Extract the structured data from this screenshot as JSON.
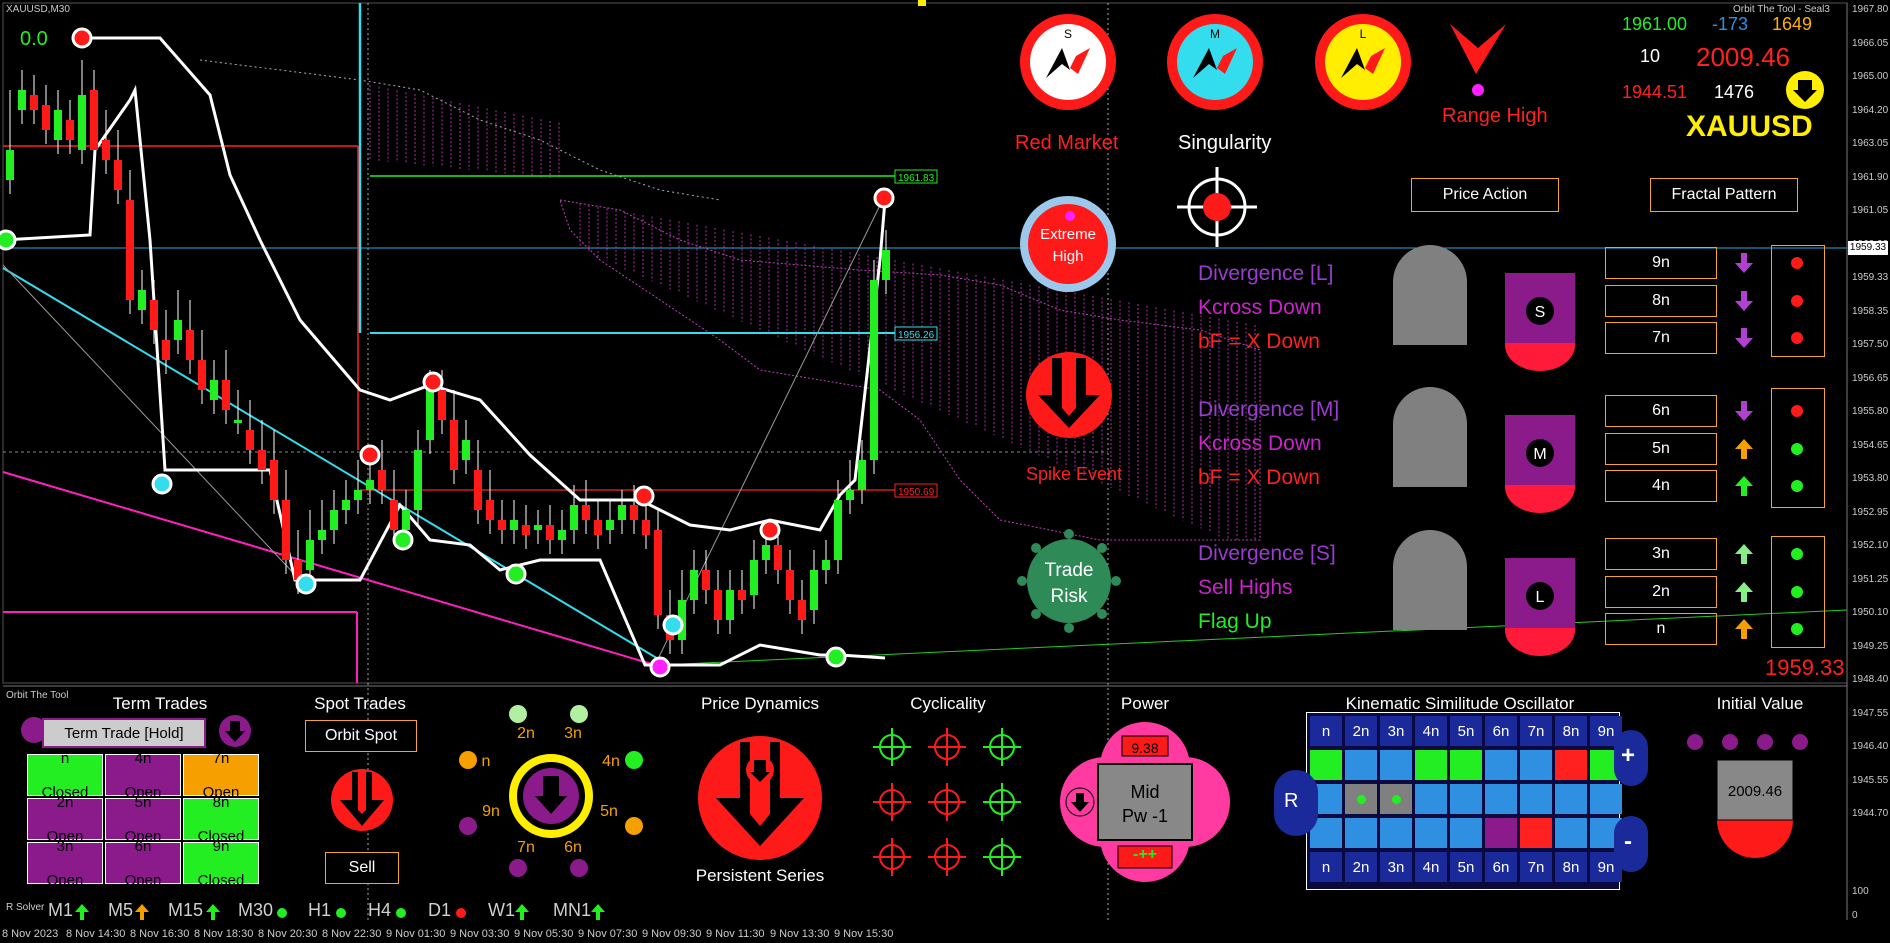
{
  "window": {
    "symbol_tf": "XAUUSD,M30",
    "brand": "Orbit The Tool - Seal3",
    "zero_label": "0.0"
  },
  "price_scale": [
    "1967.80",
    "1966.05",
    "1965.00",
    "1964.20",
    "1963.05",
    "1961.90",
    "1961.05",
    "1960.20",
    "1959.33",
    "1958.35",
    "1957.50",
    "1956.65",
    "1955.80",
    "1954.65",
    "1953.80",
    "1952.95",
    "1952.10",
    "1951.25",
    "1950.10",
    "1949.25",
    "1948.40",
    "1947.55",
    "1946.40",
    "1945.55",
    "1944.70"
  ],
  "current_price": "1959.33",
  "price_tags": {
    "top_green": "1961.83",
    "cyan": "1956.26",
    "red": "1950.69"
  },
  "time_axis": [
    "8 Nov 2023",
    "8 Nov 14:30",
    "8 Nov 16:30",
    "8 Nov 18:30",
    "8 Nov 20:30",
    "8 Nov 22:30",
    "9 Nov 01:30",
    "9 Nov 03:30",
    "9 Nov 05:30",
    "9 Nov 07:30",
    "9 Nov 09:30",
    "9 Nov 11:30",
    "9 Nov 13:30",
    "9 Nov 15:30"
  ],
  "bottom_scale": {
    "top": "100",
    "bottom": "0"
  },
  "top_right": {
    "v1": "1961.00",
    "v2": "-173",
    "v3": "1649",
    "v4": "10",
    "v5": "2009.46",
    "v6": "1944.51",
    "v7": "1476",
    "symbol": "XAUUSD"
  },
  "indicators": {
    "s_letter": "S",
    "m_letter": "M",
    "l_letter": "L",
    "red_market": "Red Market",
    "singularity": "Singularity",
    "range_high": "Range High",
    "extreme_high_1": "Extreme",
    "extreme_high_2": "High",
    "spike_event": "Spike Event",
    "trade_risk_1": "Trade",
    "trade_risk_2": "Risk",
    "price_action": "Price Action",
    "fractal_pattern": "Fractal Pattern"
  },
  "signals": {
    "l": [
      "Divergence [L]",
      "Kcross Down",
      "bF = X Down"
    ],
    "m": [
      "Divergence [M]",
      "Kcross Down",
      "bF = X Down"
    ],
    "s": [
      "Divergence [S]",
      "Sell Highs",
      "Flag Up"
    ]
  },
  "tf_gauges": [
    "S",
    "M",
    "L"
  ],
  "n_levels": [
    {
      "label": "9n",
      "arrow": "down",
      "dot": "red"
    },
    {
      "label": "8n",
      "arrow": "down",
      "dot": "red"
    },
    {
      "label": "7n",
      "arrow": "down",
      "dot": "red"
    },
    {
      "label": "6n",
      "arrow": "down",
      "dot": "red"
    },
    {
      "label": "5n",
      "arrow": "up-orange",
      "dot": "green"
    },
    {
      "label": "4n",
      "arrow": "up-green",
      "dot": "green"
    },
    {
      "label": "3n",
      "arrow": "up-lime",
      "dot": "green"
    },
    {
      "label": "2n",
      "arrow": "up-lime",
      "dot": "green"
    },
    {
      "label": "n",
      "arrow": "up-orange",
      "dot": "green"
    }
  ],
  "bottom": {
    "orbit_label": "Orbit The Tool",
    "term_title": "Term Trades",
    "term_hold": "Term Trade [Hold]",
    "term_cells": [
      {
        "l1": "n",
        "l2": "Closed",
        "color": "#22ee22"
      },
      {
        "l1": "4n",
        "l2": "Open",
        "color": "#8b1a8b"
      },
      {
        "l1": "7n",
        "l2": "Open",
        "color": "#f5a000"
      },
      {
        "l1": "2n",
        "l2": "Open",
        "color": "#8b1a8b"
      },
      {
        "l1": "5n",
        "l2": "Open",
        "color": "#8b1a8b"
      },
      {
        "l1": "8n",
        "l2": "Closed",
        "color": "#22ee22"
      },
      {
        "l1": "3n",
        "l2": "Open",
        "color": "#8b1a8b"
      },
      {
        "l1": "6n",
        "l2": "Open",
        "color": "#8b1a8b"
      },
      {
        "l1": "9n",
        "l2": "Closed",
        "color": "#22ee22"
      }
    ],
    "spot_title": "Spot Trades",
    "orbit_spot": "Orbit Spot",
    "sell": "Sell",
    "orbit_labels": [
      "2n",
      "3n",
      "n",
      "4n",
      "9n",
      "5n",
      "7n",
      "6n"
    ],
    "price_dynamics": "Price Dynamics",
    "persistent_series": "Persistent Series",
    "cyclicality": "Cyclicality",
    "power": "Power",
    "power_value": "9.38",
    "power_mid": "Mid",
    "power_pw": "Pw -1",
    "power_signs": "-++",
    "kso_title": "Kinematic Similitude Oscillator",
    "kso_header": [
      "n",
      "2n",
      "3n",
      "4n",
      "5n",
      "6n",
      "7n",
      "8n",
      "9n"
    ],
    "kso_row1": [
      "#22ee22",
      "#2f8fe0",
      "#2f8fe0",
      "#22ee22",
      "#22ee22",
      "#2f8fe0",
      "#2f8fe0",
      "#ff2020",
      "#22ee22"
    ],
    "kso_row2": [
      "#2f8fe0",
      "#808080",
      "#808080",
      "#2f8fe0",
      "#2f8fe0",
      "#2f8fe0",
      "#2f8fe0",
      "#2f8fe0",
      "#2f8fe0"
    ],
    "kso_row3": [
      "#2f8fe0",
      "#2f8fe0",
      "#2f8fe0",
      "#2f8fe0",
      "#2f8fe0",
      "#8b1a8b",
      "#ff2020",
      "#2f8fe0",
      "#2f8fe0"
    ],
    "kso_r": "R",
    "kso_plus": "+",
    "kso_minus": "-",
    "initial_value_title": "Initial Value",
    "initial_value": "2009.46",
    "r_solver": "R Solver",
    "timeframes": [
      "M1",
      "M5",
      "M15",
      "M30",
      "H1",
      "H4",
      "D1",
      "W1",
      "MN1"
    ]
  },
  "colors": {
    "red": "#ff1a1a",
    "green": "#22ee22",
    "purple": "#8b1a8b",
    "orange": "#f5a000",
    "cyan": "#33ddee",
    "yellow": "#ffee00"
  }
}
